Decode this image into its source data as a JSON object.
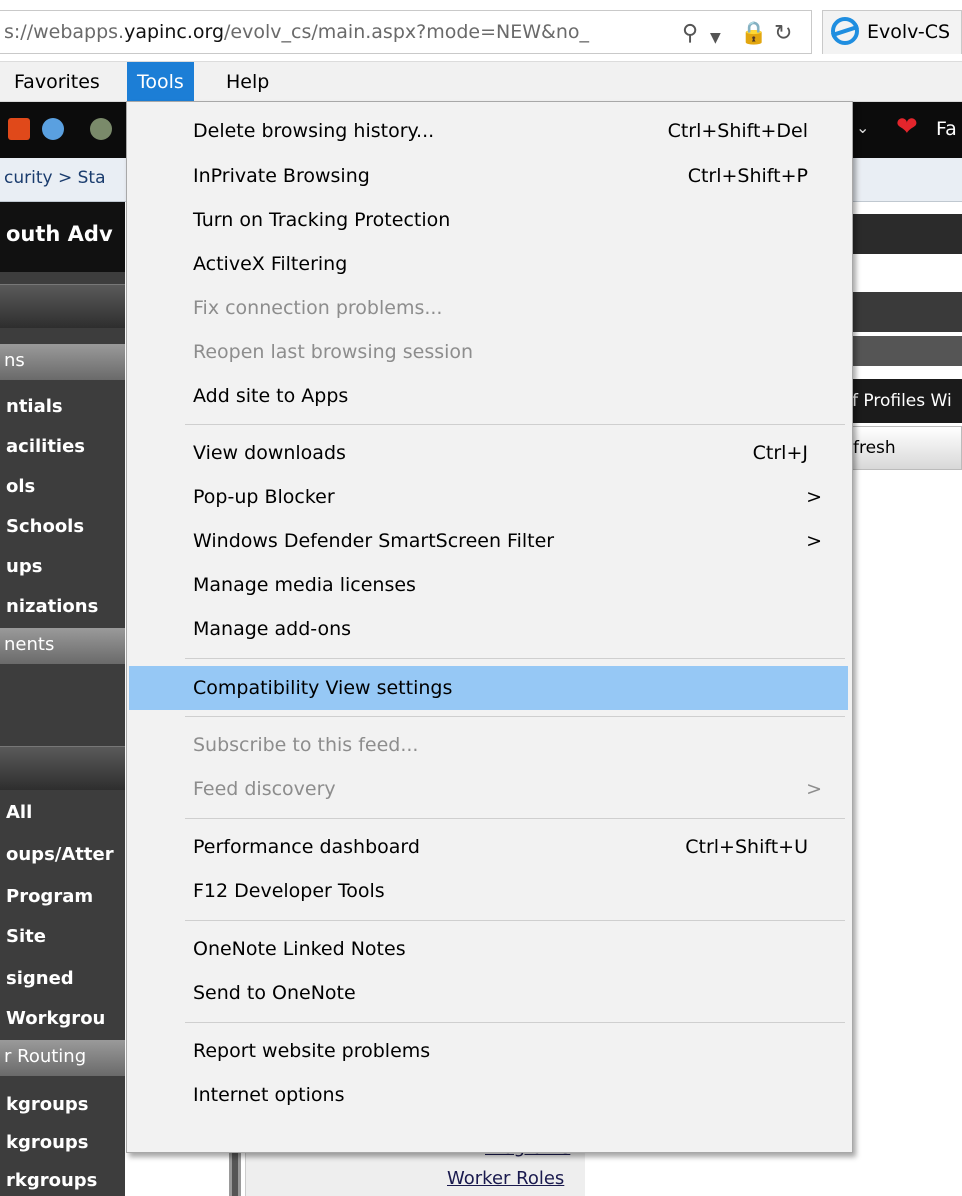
{
  "addressbar": {
    "url_prefix": "s://webapps.",
    "url_domain": "yapinc.org",
    "url_rest": "/evolv_cs/main.aspx?mode=NEW&no_",
    "search_icon": "search-icon",
    "tab_title": "Evolv-CS"
  },
  "menubar": {
    "favorites": "Favorites",
    "tools": "Tools",
    "help": "Help"
  },
  "background": {
    "toolbar_fav_text": "Fa",
    "breadcrumb": "curity > Sta",
    "app_title": "outh Adv",
    "right_profiles": "f Profiles Wi",
    "right_refresh": "fresh",
    "nav_sub_1": "ns",
    "nav_sub_2": "nents",
    "nav_sub_3": "r Routing",
    "nav_items_a": [
      "ntials",
      "acilities",
      "ols",
      "Schools",
      "ups",
      "nizations"
    ],
    "nav_items_b": [
      "All",
      "oups/Atter",
      "Program",
      "Site",
      "signed",
      "Workgrou"
    ],
    "nav_items_c": [
      "kgroups",
      "kgroups",
      "rkgroups"
    ],
    "bottom_links": [
      "Programs",
      "Worker Roles"
    ]
  },
  "tools_menu": {
    "items": [
      {
        "label": "Delete browsing history...",
        "shortcut": "Ctrl+Shift+Del"
      },
      {
        "label": "InPrivate Browsing",
        "shortcut": "Ctrl+Shift+P"
      },
      {
        "label": "Turn on Tracking Protection",
        "shortcut": ""
      },
      {
        "label": "ActiveX Filtering",
        "shortcut": ""
      },
      {
        "label": "Fix connection problems...",
        "shortcut": ""
      },
      {
        "label": "Reopen last browsing session",
        "shortcut": ""
      },
      {
        "label": "Add site to Apps",
        "shortcut": ""
      },
      {
        "label": "View downloads",
        "shortcut": "Ctrl+J"
      },
      {
        "label": "Pop-up Blocker",
        "shortcut": ""
      },
      {
        "label": "Windows Defender SmartScreen Filter",
        "shortcut": ""
      },
      {
        "label": "Manage media licenses",
        "shortcut": ""
      },
      {
        "label": "Manage add-ons",
        "shortcut": ""
      },
      {
        "label": "Compatibility View settings",
        "shortcut": ""
      },
      {
        "label": "Subscribe to this feed...",
        "shortcut": ""
      },
      {
        "label": "Feed discovery",
        "shortcut": ""
      },
      {
        "label": "Performance dashboard",
        "shortcut": "Ctrl+Shift+U"
      },
      {
        "label": "F12 Developer Tools",
        "shortcut": ""
      },
      {
        "label": "OneNote Linked Notes",
        "shortcut": ""
      },
      {
        "label": "Send to OneNote",
        "shortcut": ""
      },
      {
        "label": "Report website problems",
        "shortcut": ""
      },
      {
        "label": "Internet options",
        "shortcut": ""
      }
    ],
    "submenu_arrow": ">"
  },
  "colors": {
    "menu_highlight": "#96c8f5",
    "menubar_active": "#1c7ed6",
    "disabled_text": "#8d8d8d"
  }
}
